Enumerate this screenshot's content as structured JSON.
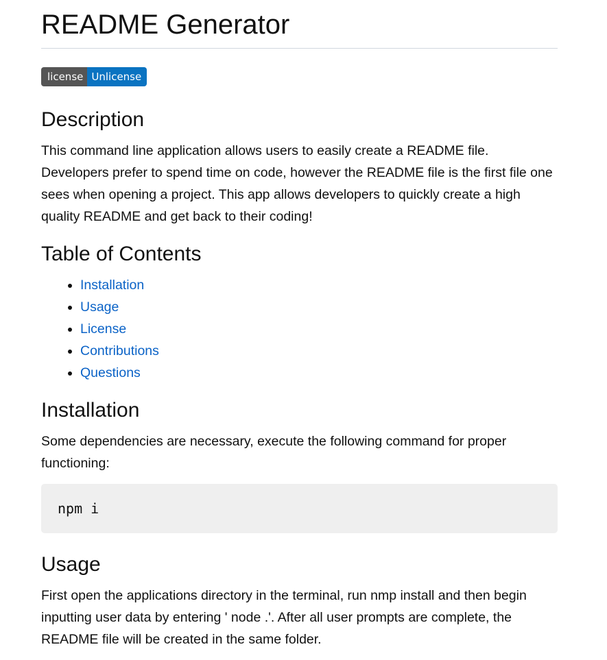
{
  "title": "README Generator",
  "badge": {
    "label": "license",
    "value": "Unlicense",
    "label_color": "#555555",
    "value_color": "#0a73c1"
  },
  "sections": {
    "description": {
      "heading": "Description",
      "text": "This command line application allows users to easily create a README file. Developers prefer to spend time on code, however the README file is the first file one sees when opening a project. This app allows developers to quickly create a high quality README and get back to their coding!"
    },
    "toc": {
      "heading": "Table of Contents",
      "items": [
        "Installation",
        "Usage",
        "License",
        "Contributions",
        "Questions"
      ]
    },
    "installation": {
      "heading": "Installation",
      "text": "Some dependencies are necessary, execute the following command for proper functioning:",
      "code": "npm i"
    },
    "usage": {
      "heading": "Usage",
      "text": "First open the applications directory in the terminal, run nmp install and then begin inputting user data by entering ' node .'. After all user prompts are complete, the README file will be created in the same folder."
    }
  },
  "colors": {
    "link": "#0b63c7",
    "code_background": "#efefef",
    "rule": "#d0d7de"
  }
}
